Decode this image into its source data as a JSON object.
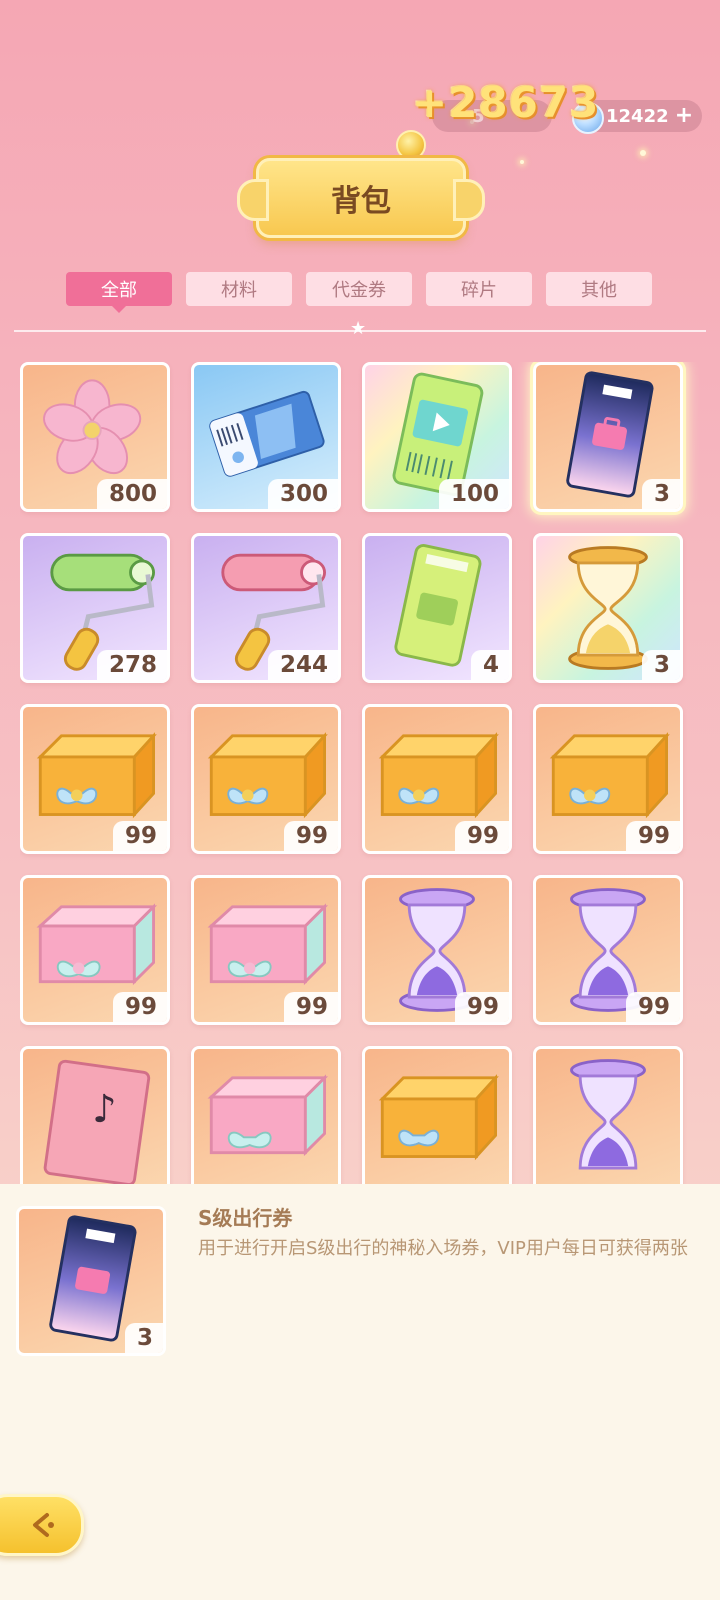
{
  "header": {
    "reward_popup": "+28673",
    "coin_amount": "5",
    "gem_amount": "12422",
    "title": "背包"
  },
  "tabs": [
    {
      "label": "全部",
      "active": true
    },
    {
      "label": "材料",
      "active": false
    },
    {
      "label": "代金券",
      "active": false
    },
    {
      "label": "碎片",
      "active": false
    },
    {
      "label": "其他",
      "active": false
    }
  ],
  "items": [
    {
      "icon": "sakura-flower-icon",
      "count": "800"
    },
    {
      "icon": "blue-ticket-icon",
      "count": "300"
    },
    {
      "icon": "video-ticket-icon",
      "count": "100"
    },
    {
      "icon": "s-class-ticket-icon",
      "count": "3"
    },
    {
      "icon": "green-paint-roller-icon",
      "count": "278"
    },
    {
      "icon": "pink-paint-roller-icon",
      "count": "244"
    },
    {
      "icon": "green-ticket-icon",
      "count": "4"
    },
    {
      "icon": "golden-hourglass-icon",
      "count": "3"
    },
    {
      "icon": "orange-gift-box-icon",
      "count": "99"
    },
    {
      "icon": "orange-gift-box-icon",
      "count": "99"
    },
    {
      "icon": "orange-gift-box-icon",
      "count": "99"
    },
    {
      "icon": "orange-gift-box-icon",
      "count": "99"
    },
    {
      "icon": "pink-gift-box-icon",
      "count": "99"
    },
    {
      "icon": "pink-gift-box-icon",
      "count": "99"
    },
    {
      "icon": "purple-hourglass-icon",
      "count": "99"
    },
    {
      "icon": "purple-hourglass-icon",
      "count": "99"
    },
    {
      "icon": "music-book-icon",
      "count": ""
    },
    {
      "icon": "pink-gift-box-icon",
      "count": ""
    },
    {
      "icon": "orange-gift-box-icon",
      "count": ""
    },
    {
      "icon": "purple-hourglass-icon",
      "count": ""
    }
  ],
  "detail": {
    "name": "S级出行券",
    "description": "用于进行开启S级出行的神秘入场券，VIP用户每日可获得两张",
    "count": "3"
  },
  "colors": {
    "tab_active": "#f06f98",
    "accent_gold": "#f8c850"
  }
}
